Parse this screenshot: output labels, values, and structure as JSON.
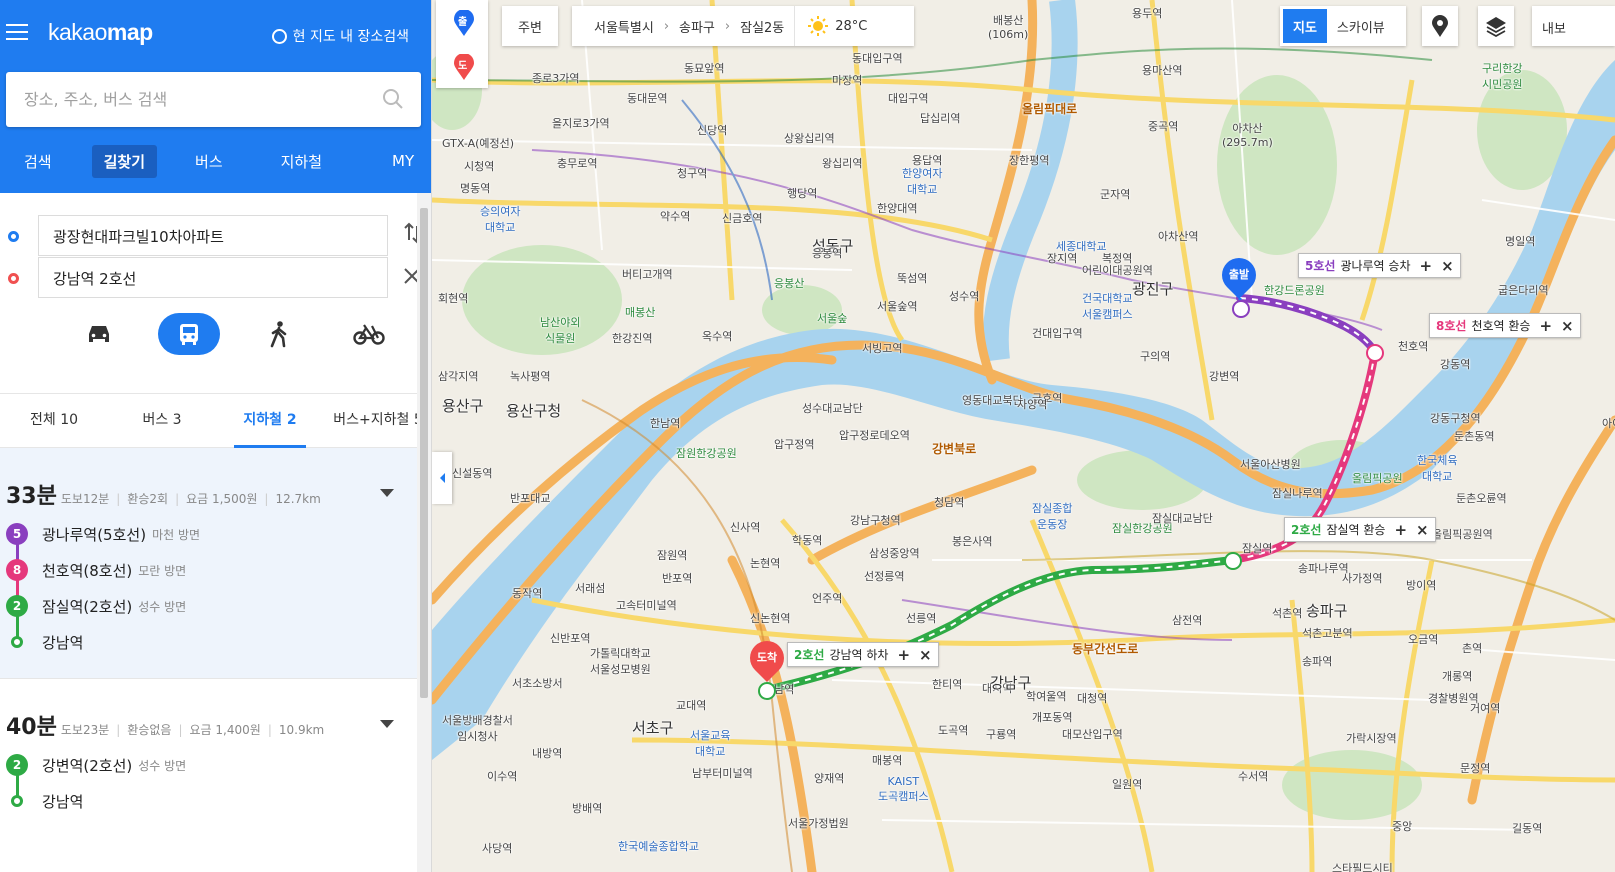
{
  "app": {
    "logo_light": "kakao",
    "logo_bold": "map",
    "area_search": "현 지도 내 장소검색"
  },
  "search": {
    "placeholder": "장소, 주소, 버스 검색"
  },
  "main_tabs": [
    {
      "label": "검색"
    },
    {
      "label": "길찾기",
      "active": true
    },
    {
      "label": "버스"
    },
    {
      "label": "지하철"
    },
    {
      "label": "MY"
    }
  ],
  "route": {
    "from": "광장현대파크빌10차아파트",
    "to": "강남역 2호선"
  },
  "modes": [
    "car-icon",
    "bus-icon",
    "walk-icon",
    "bike-icon"
  ],
  "filter_tabs": [
    {
      "label": "전체 10"
    },
    {
      "label": "버스 3"
    },
    {
      "label": "지하철 2",
      "active": true
    },
    {
      "label": "버스+지하철 5"
    }
  ],
  "results": [
    {
      "time": "33분",
      "walk": "도보12분",
      "transfer": "환승2회",
      "fare": "요금 1,500원",
      "dist": "12.7km",
      "steps": [
        {
          "badge": "5",
          "color": "#8a3fbf",
          "name": "광나루역(5호선)",
          "dir": "마천 방면"
        },
        {
          "badge": "8",
          "color": "#e5387c",
          "name": "천호역(8호선)",
          "dir": "모란 방면"
        },
        {
          "badge": "2",
          "color": "#2eaa45",
          "name": "잠실역(2호선)",
          "dir": "성수 방면"
        },
        {
          "badge": "",
          "color": "#2eaa45",
          "name": "강남역",
          "dir": ""
        }
      ]
    },
    {
      "time": "40분",
      "walk": "도보23분",
      "transfer": "환승없음",
      "fare": "요금 1,400원",
      "dist": "10.9km",
      "steps": [
        {
          "badge": "2",
          "color": "#2eaa45",
          "name": "강변역(2호선)",
          "dir": "성수 방면"
        },
        {
          "badge": "",
          "color": "#2eaa45",
          "name": "강남역",
          "dir": ""
        }
      ]
    }
  ],
  "map": {
    "nearby": "주변",
    "breadcrumb": [
      "서울특별시",
      "송파구",
      "잠실2동"
    ],
    "temperature": "28°C",
    "maptype": {
      "map": "지도",
      "skyview": "스카이뷰"
    },
    "mylist": "내보",
    "pin_start": "출",
    "pin_end": "도",
    "markers": {
      "start": "출발",
      "end": "도착"
    },
    "callouts": [
      {
        "line": "5호선",
        "color": "#8a3fbf",
        "text": "광나루역 승차"
      },
      {
        "line": "8호선",
        "color": "#e5387c",
        "text": "천호역 환승"
      },
      {
        "line": "2호선",
        "color": "#2eaa45",
        "text": "잠실역 환승"
      },
      {
        "line": "2호선",
        "color": "#2eaa45",
        "text": "강남역 하차"
      }
    ],
    "labels": [
      {
        "t": "배봉산\n(106m)",
        "c": ""
      },
      {
        "t": "아차산\n(295.7m)",
        "c": ""
      },
      {
        "t": "구리한강\n시민공원",
        "c": "green"
      },
      {
        "t": "동묘앞역",
        "c": ""
      },
      {
        "t": "종로3가역",
        "c": ""
      },
      {
        "t": "을지로3가역",
        "c": ""
      },
      {
        "t": "동대문역",
        "c": ""
      },
      {
        "t": "신당역",
        "c": ""
      },
      {
        "t": "상왕십리역",
        "c": ""
      },
      {
        "t": "왕십리역",
        "c": ""
      },
      {
        "t": "청구역",
        "c": ""
      },
      {
        "t": "충무로역",
        "c": ""
      },
      {
        "t": "약수역",
        "c": ""
      },
      {
        "t": "신금호역",
        "c": ""
      },
      {
        "t": "행당역",
        "c": ""
      },
      {
        "t": "한양대역",
        "c": ""
      },
      {
        "t": "한양여자\n대학교",
        "c": "blue"
      },
      {
        "t": "용답역",
        "c": ""
      },
      {
        "t": "답십리역",
        "c": ""
      },
      {
        "t": "마장역",
        "c": ""
      },
      {
        "t": "장한평역",
        "c": ""
      },
      {
        "t": "군자역",
        "c": ""
      },
      {
        "t": "아차산역",
        "c": ""
      },
      {
        "t": "중곡역",
        "c": ""
      },
      {
        "t": "용마산역",
        "c": ""
      },
      {
        "t": "세종대학교",
        "c": "blue"
      },
      {
        "t": "어린이대공원역",
        "c": ""
      },
      {
        "t": "광진구",
        "c": "big"
      },
      {
        "t": "건국대학교\n서울캠퍼스",
        "c": "blue"
      },
      {
        "t": "성수역",
        "c": ""
      },
      {
        "t": "뚝섬역",
        "c": ""
      },
      {
        "t": "서울숲역",
        "c": ""
      },
      {
        "t": "서울숲",
        "c": "green"
      },
      {
        "t": "건대입구역",
        "c": ""
      },
      {
        "t": "구의역",
        "c": ""
      },
      {
        "t": "강변역",
        "c": ""
      },
      {
        "t": "한강드론공원",
        "c": "green"
      },
      {
        "t": "천호역",
        "c": ""
      },
      {
        "t": "강동역",
        "c": ""
      },
      {
        "t": "강동구청역",
        "c": ""
      },
      {
        "t": "명일역",
        "c": ""
      },
      {
        "t": "굽은다리역",
        "c": ""
      },
      {
        "t": "성동구",
        "c": "big"
      },
      {
        "t": "응봉역",
        "c": ""
      },
      {
        "t": "응봉산",
        "c": "green"
      },
      {
        "t": "버티고개역",
        "c": ""
      },
      {
        "t": "매봉산",
        "c": "green"
      },
      {
        "t": "남산야외\n식물원",
        "c": "green"
      },
      {
        "t": "한강진역",
        "c": ""
      },
      {
        "t": "옥수역",
        "c": ""
      },
      {
        "t": "금호역",
        "c": ""
      },
      {
        "t": "승의여자\n대학교",
        "c": "blue"
      },
      {
        "t": "용산구",
        "c": "big"
      },
      {
        "t": "용산구청",
        "c": "big"
      },
      {
        "t": "녹사평역",
        "c": ""
      },
      {
        "t": "삼각지역",
        "c": ""
      },
      {
        "t": "한남역",
        "c": ""
      },
      {
        "t": "잠원한강공원",
        "c": "green"
      },
      {
        "t": "압구정역",
        "c": ""
      },
      {
        "t": "압구정로데오역",
        "c": ""
      },
      {
        "t": "성수대교남단",
        "c": ""
      },
      {
        "t": "영동대교북단",
        "c": ""
      },
      {
        "t": "자양역",
        "c": ""
      },
      {
        "t": "청담역",
        "c": ""
      },
      {
        "t": "강남구청역",
        "c": ""
      },
      {
        "t": "잠실종합\n운동장",
        "c": "blue"
      },
      {
        "t": "잠실한강공원",
        "c": "green"
      },
      {
        "t": "잠실대교남단",
        "c": ""
      },
      {
        "t": "서울아산병원",
        "c": ""
      },
      {
        "t": "잠실나루역",
        "c": ""
      },
      {
        "t": "잠실역",
        "c": ""
      },
      {
        "t": "송파나루역",
        "c": ""
      },
      {
        "t": "올림픽공원",
        "c": "green"
      },
      {
        "t": "한국체육\n대학교",
        "c": "blue"
      },
      {
        "t": "둔촌동역",
        "c": ""
      },
      {
        "t": "둔촌오륜역",
        "c": ""
      },
      {
        "t": "올림픽공원역",
        "c": ""
      },
      {
        "t": "방이역",
        "c": ""
      },
      {
        "t": "석촌역",
        "c": ""
      },
      {
        "t": "송파구",
        "c": "big"
      },
      {
        "t": "석촌고분역",
        "c": ""
      },
      {
        "t": "삼전역",
        "c": ""
      },
      {
        "t": "송파역",
        "c": ""
      },
      {
        "t": "오금역",
        "c": ""
      },
      {
        "t": "개롱역",
        "c": ""
      },
      {
        "t": "경찰병원역",
        "c": ""
      },
      {
        "t": "거여역",
        "c": ""
      },
      {
        "t": "가락시장역",
        "c": ""
      },
      {
        "t": "문정역",
        "c": ""
      },
      {
        "t": "신사역",
        "c": ""
      },
      {
        "t": "학동역",
        "c": ""
      },
      {
        "t": "삼성중앙역",
        "c": ""
      },
      {
        "t": "선정릉역",
        "c": ""
      },
      {
        "t": "봉은사역",
        "c": ""
      },
      {
        "t": "잠원역",
        "c": ""
      },
      {
        "t": "논현역",
        "c": ""
      },
      {
        "t": "반포역",
        "c": ""
      },
      {
        "t": "고속터미널역",
        "c": ""
      },
      {
        "t": "신논현역",
        "c": ""
      },
      {
        "t": "언주역",
        "c": ""
      },
      {
        "t": "선릉역",
        "c": ""
      },
      {
        "t": "가톨릭대학교\n서울성모병원",
        "c": ""
      },
      {
        "t": "강남역",
        "c": ""
      },
      {
        "t": "교대역",
        "c": ""
      },
      {
        "t": "서울교육\n대학교",
        "c": "blue"
      },
      {
        "t": "서초구",
        "c": "big"
      },
      {
        "t": "한티역",
        "c": ""
      },
      {
        "t": "대치역",
        "c": ""
      },
      {
        "t": "학여울역",
        "c": ""
      },
      {
        "t": "대청역",
        "c": ""
      },
      {
        "t": "강남구",
        "c": "big"
      },
      {
        "t": "도곡역",
        "c": ""
      },
      {
        "t": "개포동역",
        "c": ""
      },
      {
        "t": "대모산입구역",
        "c": ""
      },
      {
        "t": "구룡역",
        "c": ""
      },
      {
        "t": "매봉역",
        "c": ""
      },
      {
        "t": "양재역",
        "c": ""
      },
      {
        "t": "KAIST\n도곡캠퍼스",
        "c": "blue"
      },
      {
        "t": "일원역",
        "c": ""
      },
      {
        "t": "수서역",
        "c": ""
      },
      {
        "t": "남부터미널역",
        "c": ""
      },
      {
        "t": "내방역",
        "c": ""
      },
      {
        "t": "이수역",
        "c": ""
      },
      {
        "t": "방배역",
        "c": ""
      },
      {
        "t": "사당역",
        "c": ""
      },
      {
        "t": "서울가정법원",
        "c": ""
      },
      {
        "t": "한국예술종합학교",
        "c": "blue"
      },
      {
        "t": "서울방배경찰서\n임시청사",
        "c": ""
      },
      {
        "t": "서초소방서",
        "c": ""
      },
      {
        "t": "신반포역",
        "c": ""
      },
      {
        "t": "동작역",
        "c": ""
      },
      {
        "t": "서래섬",
        "c": ""
      },
      {
        "t": "반포대교",
        "c": ""
      },
      {
        "t": "서빙고역",
        "c": ""
      },
      {
        "t": "강변북로",
        "c": "road"
      },
      {
        "t": "올림픽대로",
        "c": "road"
      },
      {
        "t": "동부간선도로",
        "c": "road"
      },
      {
        "t": "GTX-A(예정선)",
        "c": ""
      },
      {
        "t": "시청역",
        "c": ""
      },
      {
        "t": "명동역",
        "c": ""
      },
      {
        "t": "회현역",
        "c": ""
      },
      {
        "t": "동대입구역",
        "c": ""
      },
      {
        "t": "대입구역",
        "c": ""
      },
      {
        "t": "용두역",
        "c": ""
      },
      {
        "t": "신설동역",
        "c": ""
      },
      {
        "t": "사가정역",
        "c": ""
      },
      {
        "t": "촌역",
        "c": ""
      },
      {
        "t": "아이들역",
        "c": ""
      },
      {
        "t": "길동역",
        "c": ""
      },
      {
        "t": "중앙",
        "c": ""
      },
      {
        "t": "스타필드시티\n위례",
        "c": ""
      },
      {
        "t": "장지역",
        "c": ""
      },
      {
        "t": "복정역",
        "c": ""
      }
    ]
  }
}
